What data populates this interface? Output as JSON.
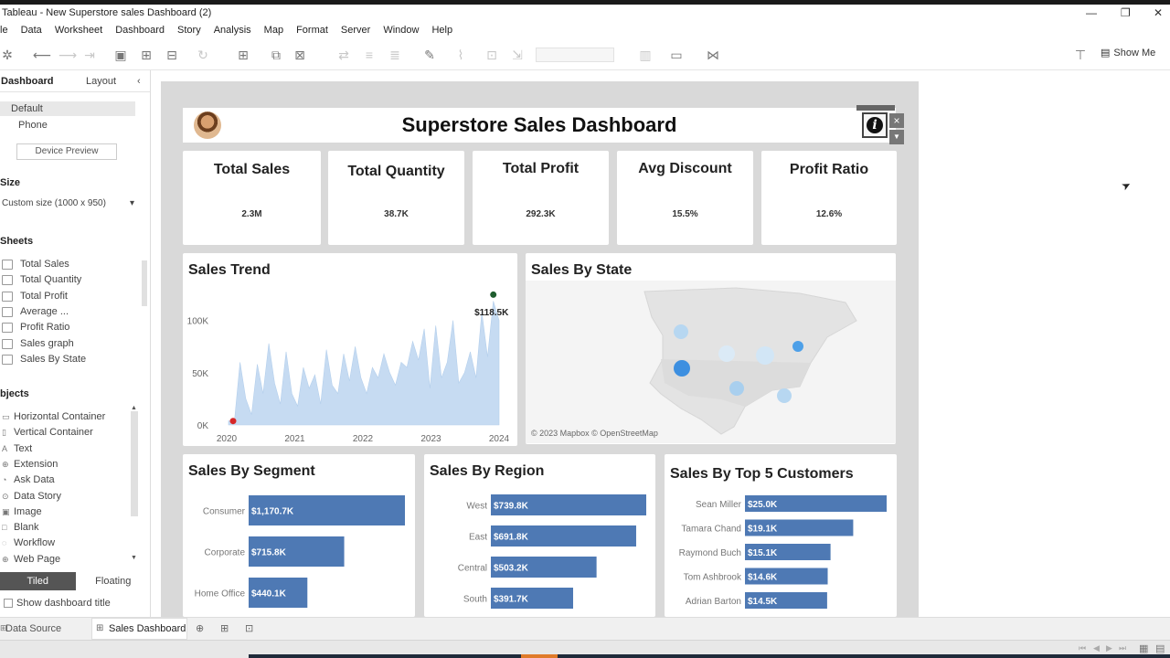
{
  "window": {
    "title": "Tableau - New Superstore sales Dashboard (2)",
    "controls": [
      "—",
      "❐",
      "✕"
    ]
  },
  "menu": [
    "le",
    "Data",
    "Worksheet",
    "Dashboard",
    "Story",
    "Analysis",
    "Map",
    "Format",
    "Server",
    "Window",
    "Help"
  ],
  "toolbar": {
    "show_me_label": "Show Me"
  },
  "sidebar": {
    "tab_dashboard": "Dashboard",
    "tab_layout": "Layout",
    "collapse": "‹",
    "device_default": "Default",
    "device_phone": "Phone",
    "device_preview": "Device Preview",
    "size_heading": "Size",
    "size_value": "Custom size (1000 x 950)",
    "sheets_heading": "Sheets",
    "sheets": [
      "Total Sales",
      "Total Quantity",
      "Total Profit",
      "Average ...",
      "Profit Ratio",
      "Sales graph",
      "Sales By State"
    ],
    "objects_heading": "bjects",
    "objects": [
      "Horizontal Container",
      "Vertical Container",
      "Text",
      "Extension",
      "Ask Data",
      "Data Story",
      "Image",
      "Blank",
      "Workflow",
      "Web Page"
    ],
    "tiled": "Tiled",
    "floating": "Floating",
    "show_title": "Show dashboard title"
  },
  "bottom": {
    "data_source": "Data Source",
    "sheet_tab": "Sales Dashboard"
  },
  "dashboard": {
    "title": "Superstore Sales Dashboard",
    "info_icon": "i",
    "kpis": [
      {
        "title": "Total Sales",
        "value": "2.3M"
      },
      {
        "title": "Total Quantity",
        "value": "38.7K"
      },
      {
        "title": "Total Profit",
        "value": "292.3K"
      },
      {
        "title": "Avg Discount",
        "value": "15.5%"
      },
      {
        "title": "Profit Ratio",
        "value": "12.6%"
      }
    ],
    "trend_title": "Sales Trend",
    "map_title": "Sales By State",
    "map_credit": "© 2023 Mapbox © OpenStreetMap",
    "segment_title": "Sales By Segment",
    "region_title": "Sales By Region",
    "customers_title": "Sales By Top 5 Customers"
  },
  "colors": {
    "bar": "#4e79b4",
    "area": "#c6dbf2",
    "max_point": "#1f5d2e",
    "min_point": "#d62728",
    "map_dot": "#5aa9e6"
  },
  "chart_data": [
    {
      "type": "area",
      "title": "Sales Trend",
      "x_ticks": [
        "2020",
        "2021",
        "2022",
        "2023",
        "2024"
      ],
      "y_ticks": [
        "0K",
        "50K",
        "100K"
      ],
      "ylim": [
        0,
        125000
      ],
      "values": [
        4000,
        2000,
        60000,
        25000,
        10000,
        58000,
        30000,
        78000,
        40000,
        20000,
        70000,
        30000,
        18000,
        55000,
        35000,
        48000,
        20000,
        72000,
        38000,
        30000,
        68000,
        42000,
        75000,
        45000,
        30000,
        55000,
        45000,
        68000,
        50000,
        38000,
        60000,
        55000,
        80000,
        62000,
        92000,
        35000,
        95000,
        45000,
        60000,
        100000,
        40000,
        50000,
        70000,
        45000,
        108000,
        65000,
        118500,
        100000
      ],
      "max_label": "$118.5K",
      "grid": false
    },
    {
      "type": "map",
      "title": "Sales By State",
      "markers": 6
    },
    {
      "type": "bar",
      "title": "Sales By Segment",
      "categories": [
        "Consumer",
        "Corporate",
        "Home Office"
      ],
      "values": [
        1170.7,
        715.8,
        440.1
      ],
      "labels": [
        "$1,170.7K",
        "$715.8K",
        "$440.1K"
      ]
    },
    {
      "type": "bar",
      "title": "Sales By Region",
      "categories": [
        "West",
        "East",
        "Central",
        "South"
      ],
      "values": [
        739.8,
        691.8,
        503.2,
        391.7
      ],
      "labels": [
        "$739.8K",
        "$691.8K",
        "$503.2K",
        "$391.7K"
      ]
    },
    {
      "type": "bar",
      "title": "Sales By Top 5 Customers",
      "categories": [
        "Sean Miller",
        "Tamara Chand",
        "Raymond Buch",
        "Tom Ashbrook",
        "Adrian Barton"
      ],
      "values": [
        25.0,
        19.1,
        15.1,
        14.6,
        14.5
      ],
      "labels": [
        "$25.0K",
        "$19.1K",
        "$15.1K",
        "$14.6K",
        "$14.5K"
      ]
    }
  ]
}
